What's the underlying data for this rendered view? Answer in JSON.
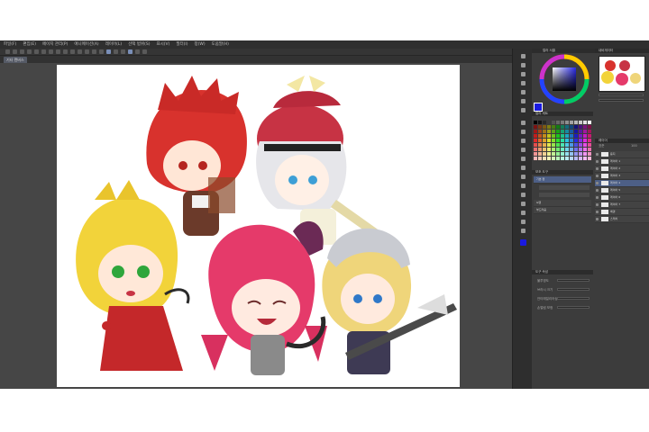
{
  "app": {
    "menu": [
      "파일(F)",
      "편집(E)",
      "페이지 관리(P)",
      "애니메이션(A)",
      "레이어(L)",
      "선택 범위(S)",
      "표시(V)",
      "필터(I)",
      "창(W)",
      "도움말(H)"
    ],
    "document_tab": "기타 캔버스"
  },
  "tool_property": {
    "section_title": "도구 속성",
    "opacity_label": "불투명도",
    "brush_size_label": "브러시 크기",
    "anti_alias_label": "안티에일리어싱",
    "stabilization_label": "손떨림 보정"
  },
  "sub_tool": {
    "section_title": "보조 도구",
    "items": [
      "기본 펜",
      "G펜",
      "부드러움"
    ]
  },
  "color_panel": {
    "section_title": "컬러 서클",
    "main_color": "#1a1ae0",
    "sub_color": "#ffffff"
  },
  "color_set": {
    "section_title": "컬러 세트"
  },
  "navigator": {
    "section_title": "내비게이터"
  },
  "layer_panel": {
    "section_title": "레이어",
    "blend_mode": "표준",
    "opacity": "100",
    "layers": [
      "용지",
      "레이어 1",
      "레이어 2",
      "레이어 3",
      "레이어 4",
      "레이어 5",
      "레이어 6",
      "레이어 7",
      "배경",
      "스케치"
    ]
  },
  "colors": {
    "app_bg": "#3a3a3a",
    "canvas_bg": "#ffffff",
    "selection": "#4d5f86",
    "accent": "#7a8fb8"
  }
}
